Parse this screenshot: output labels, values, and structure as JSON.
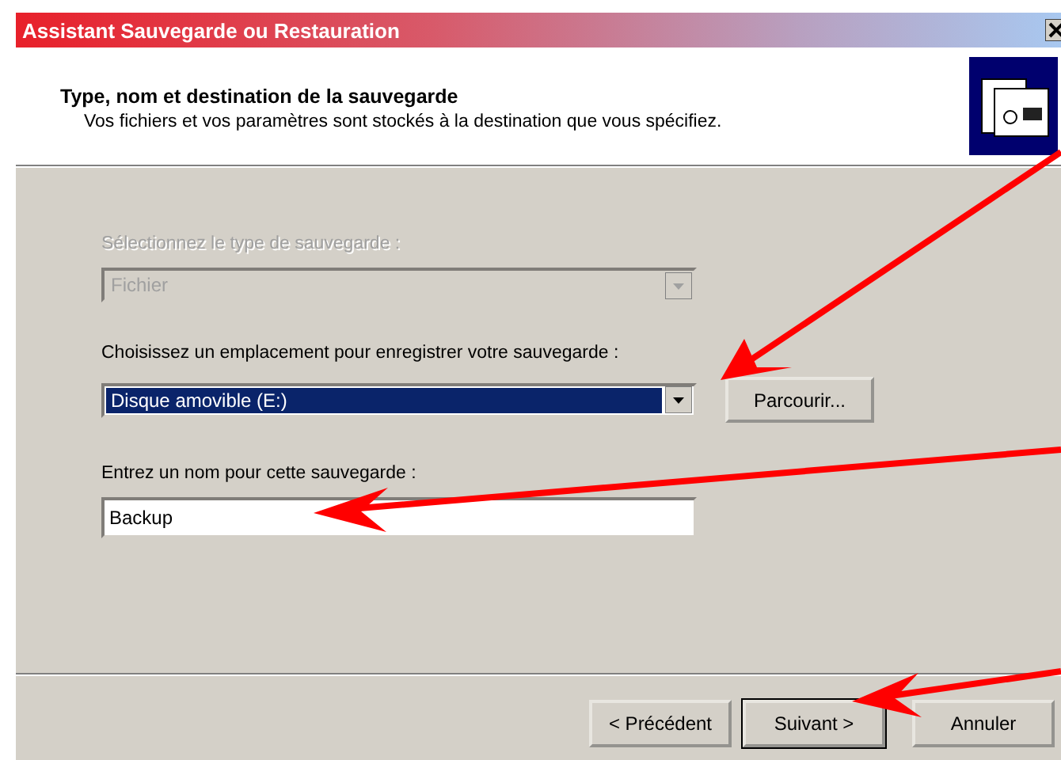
{
  "window": {
    "title": "Assistant Sauvegarde ou Restauration"
  },
  "header": {
    "title": "Type, nom et destination de la sauvegarde",
    "subtitle": "Vos fichiers et vos paramètres sont stockés à la destination que vous spécifiez."
  },
  "fields": [
    {
      "kind": "combo",
      "label": "Sélectionnez le type de sauvegarde :",
      "value": "Fichier",
      "disabled": true,
      "selected": false
    },
    {
      "kind": "combo",
      "label": "Choisissez un emplacement pour enregistrer votre sauvegarde :",
      "value": "Disque amovible (E:)",
      "disabled": false,
      "selected": true,
      "button": "Parcourir..."
    },
    {
      "kind": "text",
      "label": "Entrez un nom pour cette sauvegarde :",
      "value": "Backup"
    }
  ],
  "buttons": [
    {
      "label": "< Précédent",
      "default": false
    },
    {
      "label": "Suivant >",
      "default": true
    },
    {
      "label": "Annuler",
      "default": false
    }
  ]
}
